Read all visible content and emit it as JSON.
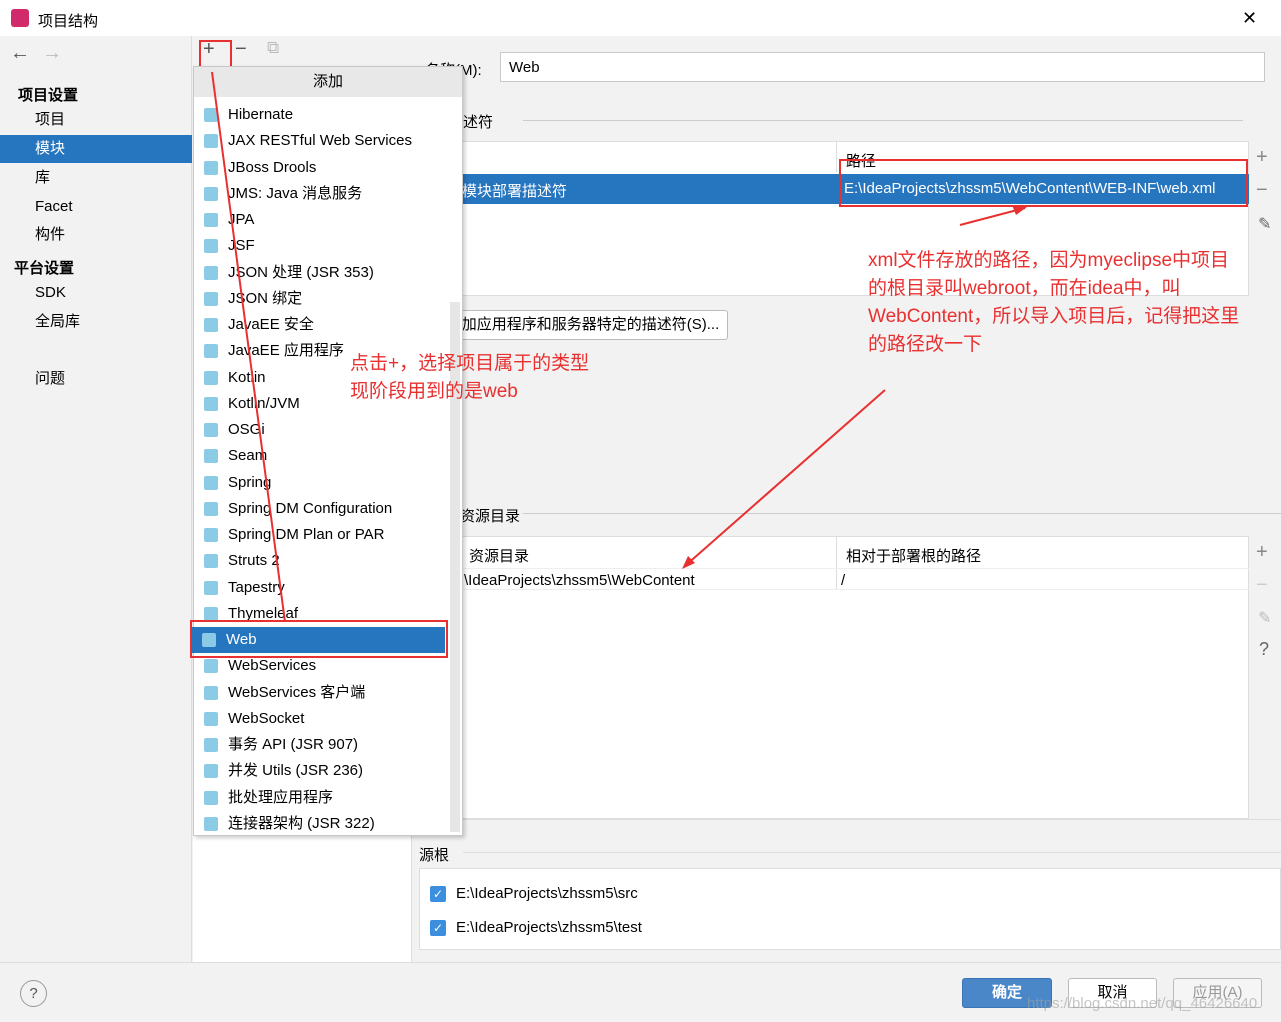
{
  "window": {
    "title": "项目结构",
    "close": "✕"
  },
  "nav": {
    "back": "←",
    "forward": "→"
  },
  "sidebar": {
    "project_settings": "项目设置",
    "items1": [
      "项目",
      "模块",
      "库",
      "Facet",
      "构件"
    ],
    "platform_settings": "平台设置",
    "items2": [
      "SDK",
      "全局库"
    ],
    "problems": "问题",
    "selected": "模块"
  },
  "toolbar": {
    "add": "+",
    "remove": "−",
    "copy": "⧉"
  },
  "popup": {
    "title": "添加",
    "items": [
      "Hibernate",
      "JAX RESTful Web Services",
      "JBoss Drools",
      "JMS: Java 消息服务",
      "JPA",
      "JSF",
      "JSON 处理 (JSR 353)",
      "JSON 绑定",
      "JavaEE 安全",
      "JavaEE 应用程序",
      "Kotlin",
      "Kotlin/JVM",
      "OSGi",
      "Seam",
      "Spring",
      "Spring DM Configuration",
      "Spring DM Plan or PAR",
      "Struts 2",
      "Tapestry",
      "Thymeleaf",
      "Web",
      "WebServices",
      "WebServices 客户端",
      "WebSocket",
      "事务 API (JSR 907)",
      "并发 Utils (JSR 236)",
      "批处理应用程序",
      "连接器架构 (JSR 322)"
    ],
    "selected": "Web"
  },
  "main": {
    "name_label": "名称(M):",
    "name_value": "Web",
    "descriptors_label": "述符",
    "desc_table": {
      "col_path": "路径",
      "row_type": "模块部署描述符",
      "row_path": "E:\\IdeaProjects\\zhssm5\\WebContent\\WEB-INF\\web.xml"
    },
    "add_server_descriptor": "加应用程序和服务器特定的描述符(S)...",
    "resource_label": "资源目录",
    "res_table": {
      "col1": "资源目录",
      "col2": "相对于部署根的路径",
      "row_dir": "\\IdeaProjects\\zhssm5\\WebContent",
      "row_rel": "/"
    },
    "source_roots_label": "源根",
    "source_roots": [
      "E:\\IdeaProjects\\zhssm5\\src",
      "E:\\IdeaProjects\\zhssm5\\test"
    ]
  },
  "annotations": {
    "note1": [
      "点击+，选择项目属于的类型",
      "现阶段用到的是web"
    ],
    "note2": [
      "xml文件存放的路径，因为myeclipse中项目",
      "的根目录叫webroot，而在idea中，叫",
      "WebContent，所以导入项目后，记得把这里",
      "的路径改一下"
    ]
  },
  "footer": {
    "help": "?",
    "ok": "确定",
    "cancel": "取消",
    "apply": "应用(A)",
    "watermark": "https://blog.csdn.net/qq_46426640"
  },
  "colors": {
    "accent": "#2675bf",
    "annotation": "#e83030"
  }
}
